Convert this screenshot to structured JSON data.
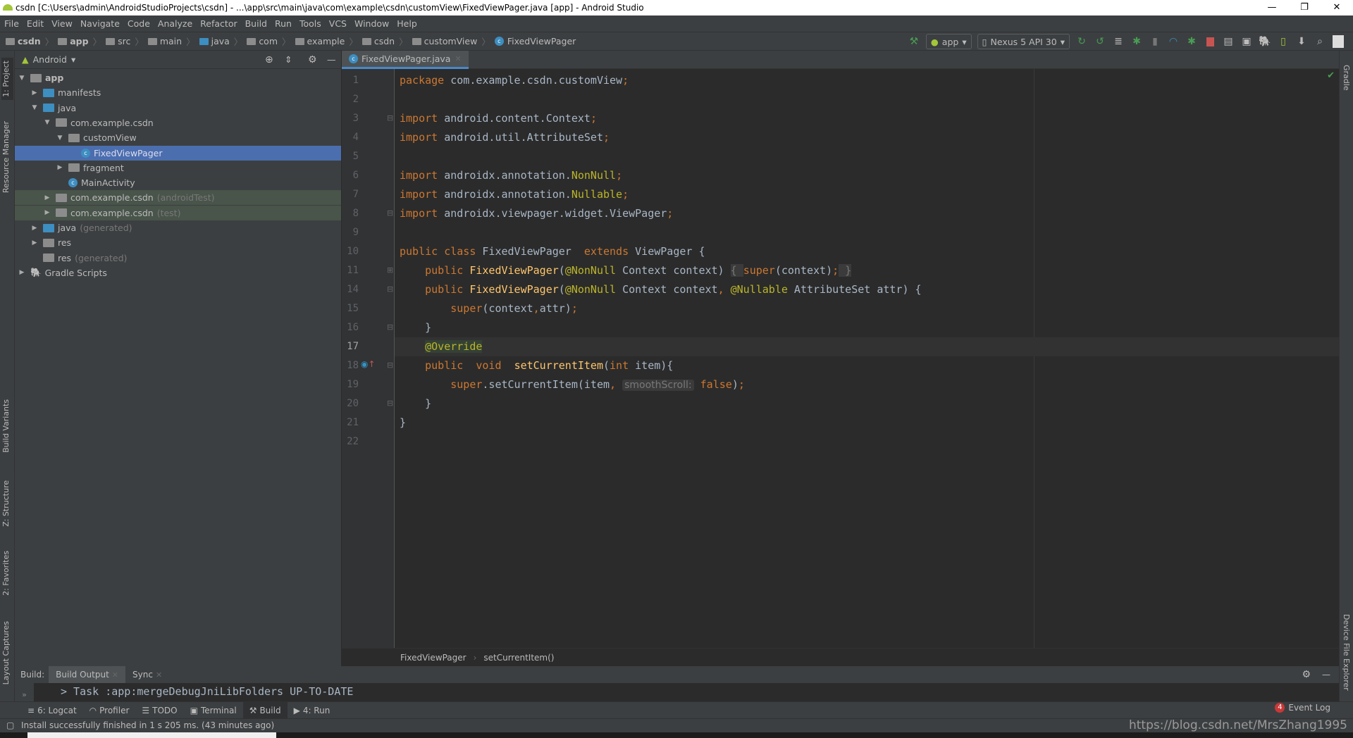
{
  "window": {
    "title": "csdn [C:\\Users\\admin\\AndroidStudioProjects\\csdn] - ...\\app\\src\\main\\java\\com\\example\\csdn\\customView\\FixedViewPager.java [app] - Android Studio",
    "minimize": "—",
    "restore": "❐",
    "close": "✕"
  },
  "menu": [
    "File",
    "Edit",
    "View",
    "Navigate",
    "Code",
    "Analyze",
    "Refactor",
    "Build",
    "Run",
    "Tools",
    "VCS",
    "Window",
    "Help"
  ],
  "nav_breadcrumb": [
    "csdn",
    "app",
    "src",
    "main",
    "java",
    "com",
    "example",
    "csdn",
    "customView",
    "FixedViewPager"
  ],
  "toolbar": {
    "run_config": "app",
    "device": "Nexus 5 API 30"
  },
  "left_stripe": [
    "1: Project",
    "Resource Manager",
    "Build Variants",
    "Z: Structure",
    "2: Favorites",
    "Layout Captures"
  ],
  "right_stripe": [
    "Gradle",
    "Device File Explorer"
  ],
  "project": {
    "view_mode": "Android",
    "tree": [
      {
        "label": "app",
        "depth": 0,
        "arrow": "▼",
        "icon": "module"
      },
      {
        "label": "manifests",
        "depth": 1,
        "arrow": "▶",
        "icon": "folder-blue"
      },
      {
        "label": "java",
        "depth": 1,
        "arrow": "▼",
        "icon": "folder-blue"
      },
      {
        "label": "com.example.csdn",
        "depth": 2,
        "arrow": "▼",
        "icon": "package"
      },
      {
        "label": "customView",
        "depth": 3,
        "arrow": "▼",
        "icon": "package"
      },
      {
        "label": "FixedViewPager",
        "depth": 4,
        "arrow": "",
        "icon": "class",
        "selected": true
      },
      {
        "label": "fragment",
        "depth": 3,
        "arrow": "▶",
        "icon": "package"
      },
      {
        "label": "MainActivity",
        "depth": 3,
        "arrow": "",
        "icon": "class"
      },
      {
        "label": "com.example.csdn",
        "suffix": "(androidTest)",
        "depth": 2,
        "arrow": "▶",
        "icon": "package",
        "test": true
      },
      {
        "label": "com.example.csdn",
        "suffix": "(test)",
        "depth": 2,
        "arrow": "▶",
        "icon": "package",
        "test": true
      },
      {
        "label": "java",
        "suffix": "(generated)",
        "depth": 1,
        "arrow": "▶",
        "icon": "folder-blue"
      },
      {
        "label": "res",
        "depth": 1,
        "arrow": "▶",
        "icon": "folder"
      },
      {
        "label": "res",
        "suffix": "(generated)",
        "depth": 1,
        "arrow": "",
        "icon": "folder"
      },
      {
        "label": "Gradle Scripts",
        "depth": 0,
        "arrow": "▶",
        "icon": "gradle"
      }
    ]
  },
  "editor": {
    "tab": "FixedViewPager.java",
    "current_line": "17",
    "lines": [
      {
        "n": "1",
        "t": [
          [
            "package",
            "kw"
          ],
          " com.example.csdn.customView",
          [
            ";",
            "kw"
          ]
        ]
      },
      {
        "n": "2",
        "t": []
      },
      {
        "n": "3",
        "t": [
          [
            "import",
            "kw"
          ],
          " android.content.Context",
          [
            ";",
            "kw"
          ]
        ]
      },
      {
        "n": "4",
        "t": [
          [
            "import",
            "kw"
          ],
          " android.util.AttributeSet",
          [
            ";",
            "kw"
          ]
        ]
      },
      {
        "n": "5",
        "t": []
      },
      {
        "n": "6",
        "t": [
          [
            "import",
            "kw"
          ],
          " androidx.annotation.",
          [
            "NonNull",
            "an"
          ],
          [
            ";",
            "kw"
          ]
        ]
      },
      {
        "n": "7",
        "t": [
          [
            "import",
            "kw"
          ],
          " androidx.annotation.",
          [
            "Nullable",
            "an"
          ],
          [
            ";",
            "kw"
          ]
        ]
      },
      {
        "n": "8",
        "t": [
          [
            "import",
            "kw"
          ],
          " androidx.viewpager.widget.ViewPager",
          [
            ";",
            "kw"
          ]
        ]
      },
      {
        "n": "9",
        "t": []
      },
      {
        "n": "10",
        "t": [
          [
            "public class",
            "kw"
          ],
          " FixedViewPager  ",
          [
            "extends",
            "kw"
          ],
          " ViewPager {"
        ]
      },
      {
        "n": "11",
        "t": [
          "    ",
          [
            "public",
            "kw"
          ],
          " ",
          [
            "FixedViewPager",
            "fn"
          ],
          "(",
          [
            "@NonNull",
            "an"
          ],
          " Context context) ",
          [
            "{ ",
            "fold-bg"
          ],
          [
            "super",
            "kw"
          ],
          "(context)",
          [
            ";",
            "kw"
          ],
          [
            " }",
            "fold-bg"
          ]
        ]
      },
      {
        "n": "14",
        "t": [
          "    ",
          [
            "public",
            "kw"
          ],
          " ",
          [
            "FixedViewPager",
            "fn"
          ],
          "(",
          [
            "@NonNull",
            "an"
          ],
          " Context context",
          [
            ",",
            "kw"
          ],
          " ",
          [
            "@Nullable",
            "an"
          ],
          " AttributeSet attr) {"
        ]
      },
      {
        "n": "15",
        "t": [
          "        ",
          [
            "super",
            "kw"
          ],
          "(context",
          [
            ",",
            "kw"
          ],
          "attr)",
          [
            ";",
            "kw"
          ]
        ]
      },
      {
        "n": "16",
        "t": [
          "    }"
        ]
      },
      {
        "n": "17",
        "t": [
          "    ",
          [
            "@Override",
            "an ovr"
          ]
        ]
      },
      {
        "n": "18",
        "t": [
          "    ",
          [
            "public",
            "kw"
          ],
          "  ",
          [
            "void",
            "kw"
          ],
          "  ",
          [
            "setCurrentItem",
            "fn"
          ],
          "(",
          [
            "int",
            "kw"
          ],
          " item){"
        ]
      },
      {
        "n": "19",
        "t": [
          "        ",
          [
            "super",
            "kw"
          ],
          ".setCurrentItem(item",
          [
            ",",
            "kw"
          ],
          " ",
          [
            "smoothScroll:",
            "hint"
          ],
          " ",
          [
            "false",
            "kw"
          ],
          ")",
          [
            ";",
            "kw"
          ]
        ]
      },
      {
        "n": "20",
        "t": [
          "    }"
        ]
      },
      {
        "n": "21",
        "t": [
          "}"
        ]
      },
      {
        "n": "22",
        "t": []
      }
    ],
    "breadcrumb": [
      "FixedViewPager",
      "setCurrentItem()"
    ]
  },
  "build": {
    "label": "Build:",
    "tabs": [
      "Build Output",
      "Sync"
    ],
    "output": "> Task :app:mergeDebugJniLibFolders UP-TO-DATE"
  },
  "tool_windows": [
    {
      "label": "6: Logcat",
      "icon": "≡"
    },
    {
      "label": "Profiler",
      "icon": "◠"
    },
    {
      "label": "TODO",
      "icon": "☰"
    },
    {
      "label": "Terminal",
      "icon": "▣"
    },
    {
      "label": "Build",
      "icon": "⚒",
      "active": true
    },
    {
      "label": "4: Run",
      "icon": "▶"
    }
  ],
  "event_log": {
    "count": "4",
    "label": "Event Log"
  },
  "status": "Install successfully finished in 1 s 205 ms. (43 minutes ago)",
  "watermark": "https://blog.csdn.net/MrsZhang1995"
}
